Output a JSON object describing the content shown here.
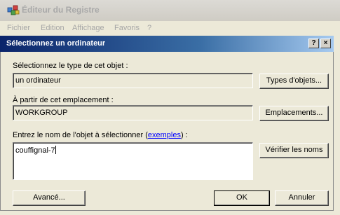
{
  "parent_window": {
    "title": "Éditeur du Registre",
    "menu": [
      "Fichier",
      "Edition",
      "Affichage",
      "Favoris",
      "?"
    ]
  },
  "dialog": {
    "title": "Sélectionnez un ordinateur",
    "help_button": "?",
    "close_button": "×",
    "object_type": {
      "label": "Sélectionnez le type de cet objet :",
      "value": "un ordinateur",
      "button": "Types d'objets..."
    },
    "location": {
      "label": "À partir de cet emplacement :",
      "value": "WORKGROUP",
      "button": "Emplacements..."
    },
    "names": {
      "label_prefix": "Entrez le nom de l'objet à sélectionner (",
      "label_link": "exemples",
      "label_suffix": ") :",
      "value": "couffignal-7",
      "button": "Vérifier les noms"
    },
    "buttons": {
      "advanced": "Avancé...",
      "ok": "OK",
      "cancel": "Annuler"
    }
  }
}
